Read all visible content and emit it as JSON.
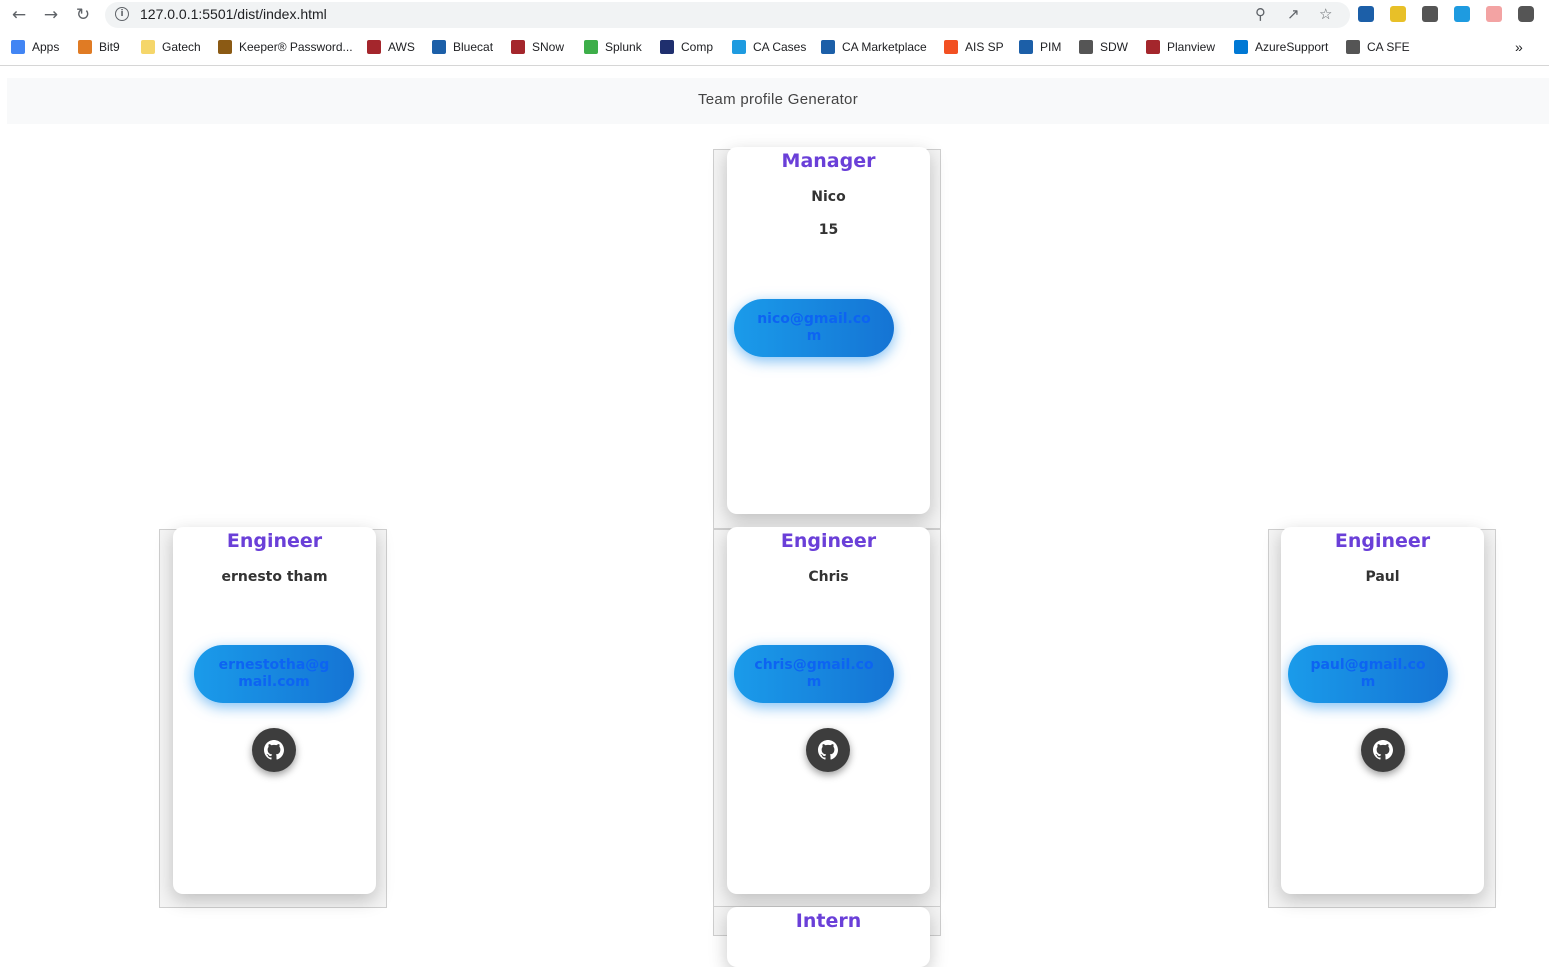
{
  "browser": {
    "url": "127.0.0.1:5501/dist/index.html",
    "bookmarks": [
      "Apps",
      "Bit9",
      "Gatech",
      "Keeper® Password...",
      "AWS",
      "Bluecat",
      "SNow",
      "Splunk",
      "Comp",
      "CA Cases",
      "CA Marketplace",
      "AIS SP",
      "PIM",
      "SDW",
      "Planview",
      "AzureSupport",
      "CA SFE"
    ],
    "more_label": "»"
  },
  "page": {
    "title": "Team profile Generator"
  },
  "cards": [
    {
      "role": "Manager",
      "name": "Nico",
      "office": "15",
      "email": "nico@gmail.com"
    },
    {
      "role": "Engineer",
      "name": "ernesto tham",
      "email": "ernestotha@gmail.com"
    },
    {
      "role": "Engineer",
      "name": "Chris",
      "email": "chris@gmail.com"
    },
    {
      "role": "Engineer",
      "name": "Paul",
      "email": "paul@gmail.com"
    },
    {
      "role": "Intern"
    }
  ],
  "colors": {
    "role": "#6a3fd8",
    "button": "#1a9bea",
    "button_text": "#0d64f2",
    "github": "#3d3d3d"
  },
  "icons": {
    "github": "github-icon"
  }
}
